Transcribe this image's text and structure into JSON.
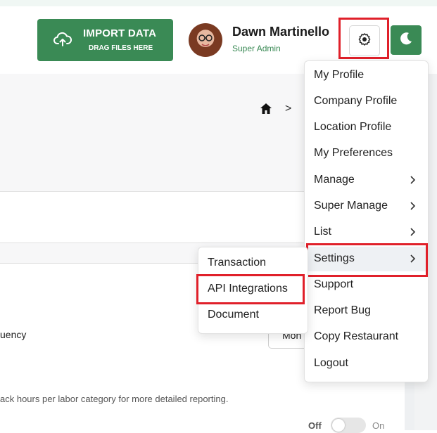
{
  "header": {
    "import_title": "IMPORT DATA",
    "import_subtitle": "DRAG FILES HERE",
    "user_name": "Dawn Martinello",
    "user_role": "Super Admin"
  },
  "colors": {
    "brand_green": "#3a8a55",
    "highlight_red": "#e0202a"
  },
  "icons": {
    "import": "cloud-upload-icon",
    "settings": "gear-icon",
    "theme": "moon-icon",
    "breadcrumb_home": "home-icon"
  },
  "breadcrumb": {
    "separator": ">"
  },
  "background_page": {
    "frequency_label": "uency",
    "frequency_select_value": "Mon",
    "description": "ack hours per labor category for more detailed reporting.",
    "toggle_off_label": "Off",
    "toggle_on_label": "On"
  },
  "user_menu": {
    "items": [
      {
        "label": "My Profile"
      },
      {
        "label": "Company Profile"
      },
      {
        "label": "Location Profile"
      },
      {
        "label": "My Preferences"
      },
      {
        "label": "Manage"
      },
      {
        "label": "Super Manage"
      },
      {
        "label": "List"
      },
      {
        "label": "Settings"
      },
      {
        "label": "Support"
      },
      {
        "label": "Report Bug"
      },
      {
        "label": "Copy Restaurant"
      },
      {
        "label": "Logout"
      }
    ]
  },
  "settings_submenu": {
    "items": [
      {
        "label": "Transaction"
      },
      {
        "label": "API Integrations"
      },
      {
        "label": "Document"
      }
    ]
  }
}
